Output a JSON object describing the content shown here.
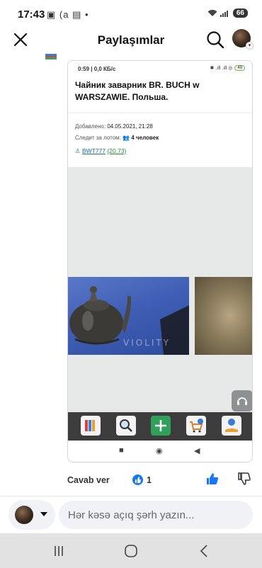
{
  "status_bar": {
    "time": "17:43",
    "icons": "▣ (a ▤ •",
    "battery": "66"
  },
  "header": {
    "title": "Paylaşımlar"
  },
  "embedded": {
    "status_time": "0:59 | 0,0 КБ/с",
    "status_icons": "✱ .ıll .ıll ◎",
    "status_battery": "49",
    "title": "Чайник заварник BR. BUCH w WARSZAWIE. Польша.",
    "added_label": "Добавлено:",
    "added_value": "04.05.2021, 21:28",
    "watch_label": "Следит за лотом:",
    "watch_value": "4 человек",
    "seller": "BWT777",
    "seller_rating": "(20,73)",
    "watermark": "VIOLITY",
    "nav": {
      "square": "■",
      "circle": "◉",
      "back": "◀"
    }
  },
  "actions": {
    "reply": "Cavab ver",
    "like_count": "1"
  },
  "composer": {
    "placeholder": "Hər kəsə açıq şərh yazın..."
  },
  "colors": {
    "facebook_blue": "#1877f2",
    "toolbar_dark": "#3c3c3c",
    "add_green": "#30a05a",
    "link_blue": "#1d6d9a"
  }
}
